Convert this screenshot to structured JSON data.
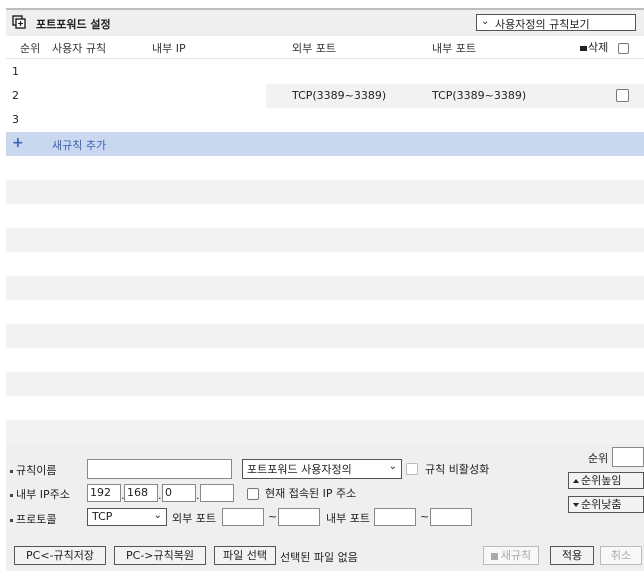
{
  "title": "포트포워드 설정",
  "view_select": "사용자정의 규칙보기",
  "columns": {
    "rank": "순위",
    "user_rule": "사용자 규칙",
    "internal_ip": "내부 IP",
    "external_port": "외부 포트",
    "internal_port": "내부 포트",
    "delete": "삭제"
  },
  "rows": [
    {
      "rank": "1",
      "external_port": "",
      "internal_port": ""
    },
    {
      "rank": "2",
      "external_port": "TCP(3389~3389)",
      "internal_port": "TCP(3389~3389)"
    },
    {
      "rank": "3",
      "external_port": "",
      "internal_port": ""
    }
  ],
  "add_rule": {
    "icon": "+",
    "label": "새규칙 추가"
  },
  "form": {
    "rank_label": "순위",
    "rule_name_label": "규칙이름",
    "rule_name_value": "",
    "rule_type_select": "포트포워드 사용자정의",
    "disable_label": "규칙 비활성화",
    "internal_ip_label": "내부 IP주소",
    "ip1": "192",
    "ip2": "168",
    "ip3": "0",
    "ip4": "",
    "current_ip_label": "현재 접속된 IP 주소",
    "protocol_label": "프로토콜",
    "protocol_value": "TCP",
    "external_port_label": "외부 포트",
    "internal_port_label": "내부 포트",
    "tilde": "~",
    "move_up": "순위높임",
    "move_down": "순위낮춤"
  },
  "bottom": {
    "save_pc": "PC<-규칙저장",
    "restore_pc": "PC->규칙복원",
    "choose_file": "파일 선택",
    "no_file": "선택된 파일 없음",
    "new_rule": "새규칙",
    "apply": "적용",
    "cancel": "취소"
  }
}
